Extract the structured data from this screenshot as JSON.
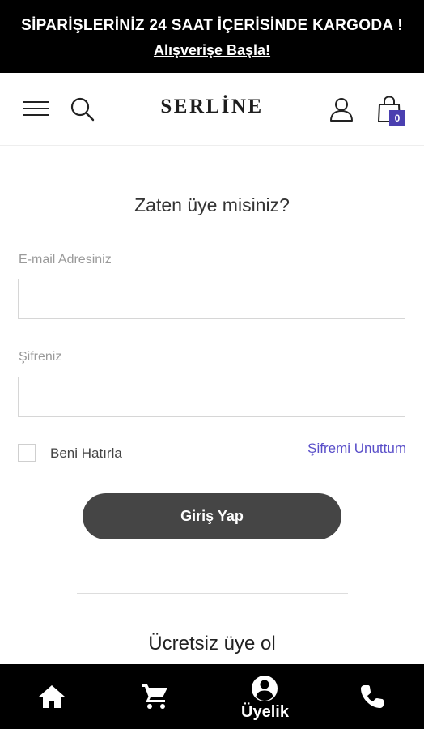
{
  "promo": {
    "headline": "SİPARİŞLERİNİZ 24 SAAT İÇERİSİNDE KARGODA !",
    "cta": "Alışverişe Başla!"
  },
  "header": {
    "logo": "SERLİNE",
    "cart_count": "0",
    "icons": [
      "menu-icon",
      "search-icon",
      "user-icon",
      "shopping-bag-icon"
    ]
  },
  "login": {
    "title": "Zaten üye misiniz?",
    "email_label": "E-mail Adresiniz",
    "email_value": "",
    "password_label": "Şifreniz",
    "password_value": "",
    "remember_label": "Beni Hatırla",
    "remember_checked": false,
    "forgot_link": "Şifremi Unuttum",
    "submit_label": "Giriş Yap"
  },
  "register": {
    "title": "Ücretsiz üye ol"
  },
  "bottom_nav": {
    "items": [
      {
        "icon": "home-icon",
        "label": ""
      },
      {
        "icon": "cart-icon",
        "label": ""
      },
      {
        "icon": "account-circle-icon",
        "label": "Üyelik"
      },
      {
        "icon": "phone-icon",
        "label": ""
      }
    ]
  },
  "colors": {
    "accent": "#4a3fb0",
    "link": "#5a4fc9",
    "button": "#454545",
    "bars": "#000000"
  }
}
